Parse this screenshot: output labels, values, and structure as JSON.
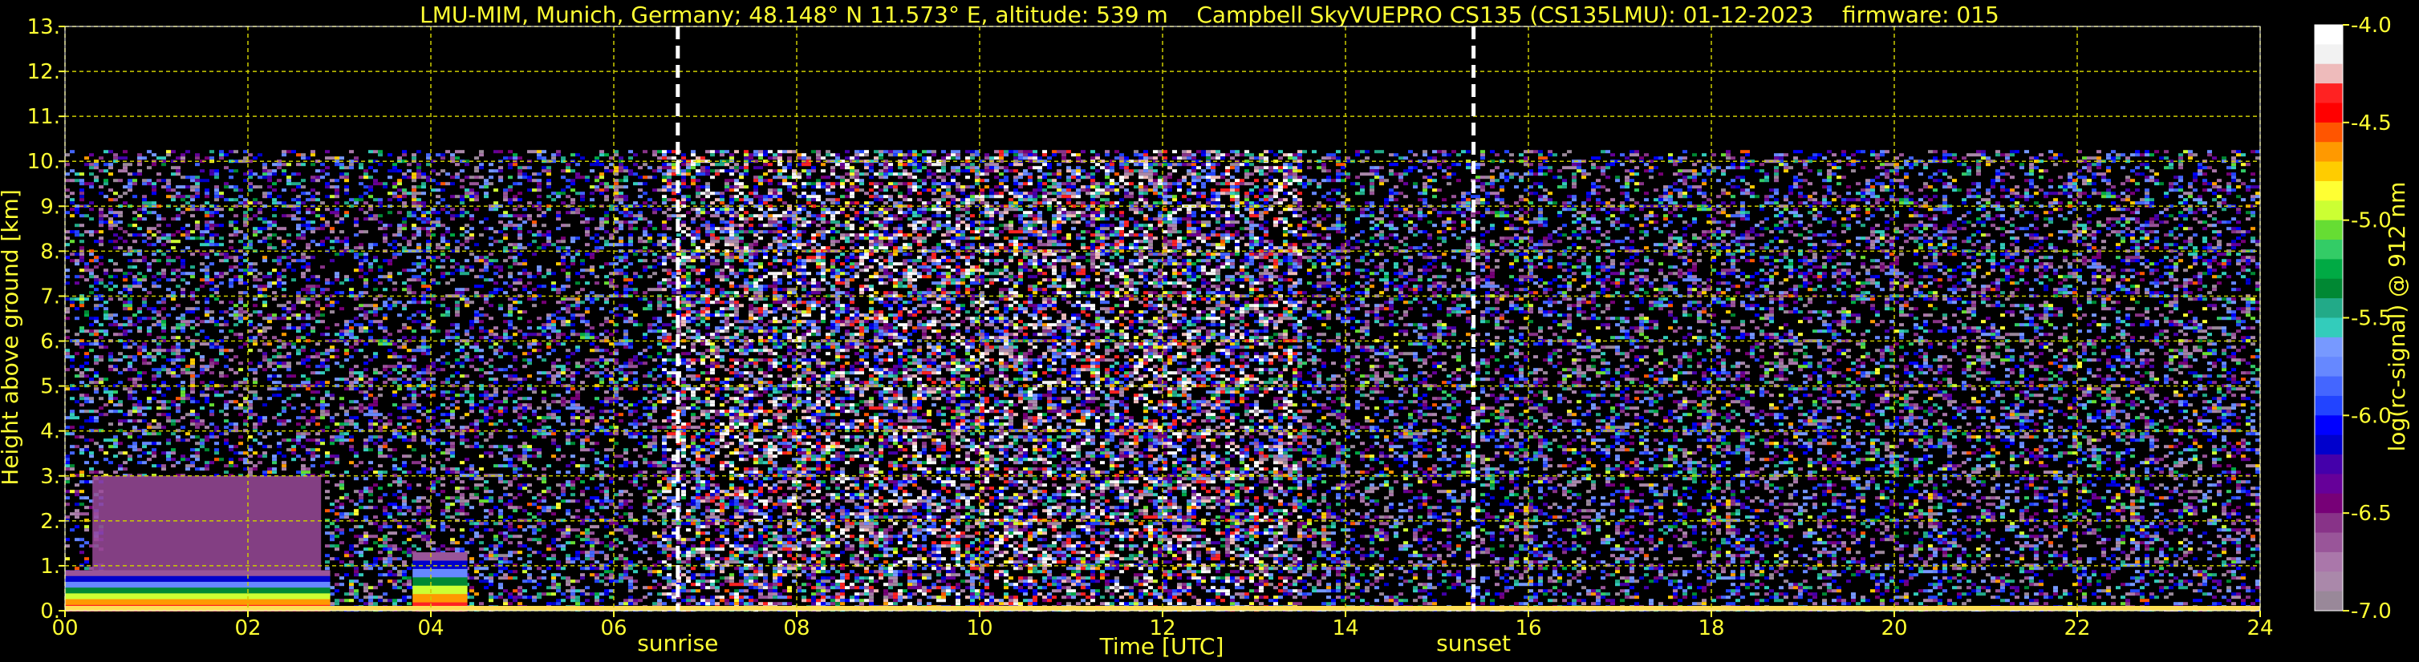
{
  "title": {
    "site": "LMU-MIM, Munich, Germany; 48.148° N 11.573° E, altitude: 539 m",
    "instrument": "Campbell SkyVUEPRO CS135 (CS135LMU): 01-12-2023",
    "firmware": "firmware: 015"
  },
  "colors": {
    "text": "#ffff33",
    "grid": "#cccc00",
    "background": "#000000",
    "marker_lines": "#ffffff"
  },
  "chart_data": {
    "type": "heatmap",
    "xlabel": "Time [UTC]",
    "ylabel": "Height above ground [km]",
    "xlim": [
      0,
      24
    ],
    "ylim": [
      0,
      13
    ],
    "xticks": [
      "00",
      "02",
      "04",
      "06",
      "08",
      "10",
      "12",
      "14",
      "16",
      "18",
      "20",
      "22",
      "24"
    ],
    "yticks": [
      "0.",
      "1.",
      "2.",
      "3.",
      "4.",
      "5.",
      "6.",
      "7.",
      "8.",
      "9.",
      "10.",
      "11.",
      "12.",
      "13."
    ],
    "grid": true,
    "annotations": [
      {
        "label": "sunrise",
        "time": 6.7
      },
      {
        "label": "sunset",
        "time": 15.4
      }
    ],
    "colorbar": {
      "label": "log(rc-signal) @ 912 nm",
      "range": [
        -7.0,
        -4.0
      ],
      "ticks": [
        "-4.0",
        "-4.5",
        "-5.0",
        "-5.5",
        "-6.0",
        "-6.5",
        "-7.0"
      ],
      "colors": [
        "#ffffff",
        "#f2f2f2",
        "#eebbbb",
        "#ff2222",
        "#ff0000",
        "#ff5500",
        "#ff9900",
        "#ffcc00",
        "#ffff33",
        "#ccff33",
        "#66dd33",
        "#33cc66",
        "#00aa44",
        "#008833",
        "#22aa88",
        "#33ccbb",
        "#7799ff",
        "#6688ff",
        "#4466ff",
        "#2244ff",
        "#0000ff",
        "#0000cc",
        "#4400aa",
        "#660099",
        "#770077",
        "#883388",
        "#995599",
        "#aa77aa",
        "#aa88aa",
        "#998899"
      ]
    },
    "overview": {
      "signal_top_km": 10.25,
      "boundary_layer": [
        {
          "start": 0.0,
          "end": 2.9,
          "top_km": 0.9
        },
        {
          "start": 3.8,
          "end": 4.4,
          "top_km": 1.3
        }
      ],
      "aerosol_layer": {
        "start": 0.3,
        "end": 2.8,
        "top_km": 3.0
      }
    }
  }
}
